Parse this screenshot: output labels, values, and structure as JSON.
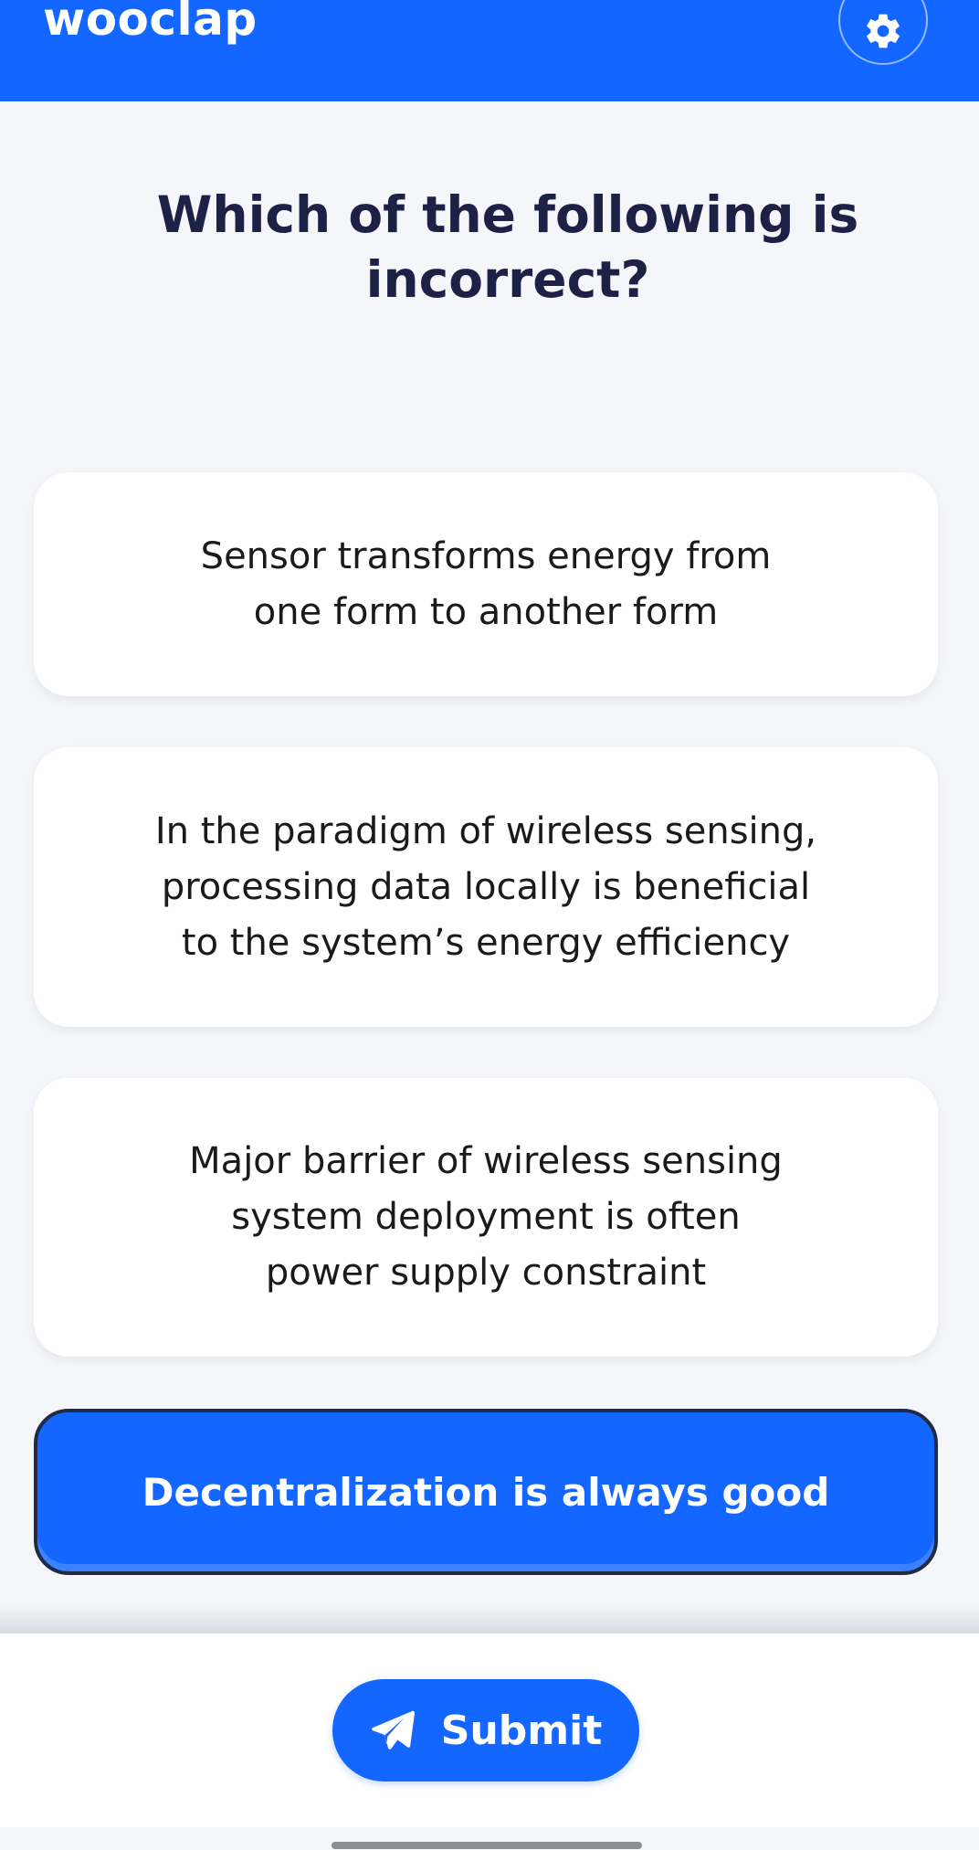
{
  "header": {
    "logo_text": "wooclap",
    "background_color": "#1366ff",
    "settings_icon": "gear-icon"
  },
  "question": {
    "text": "Which of the following is incorrect?"
  },
  "options": [
    {
      "label": "Sensor transforms energy from one form to another form",
      "selected": false
    },
    {
      "label": "In the paradigm of wireless sensing, processing data locally is beneficial to the system’s energy efficiency",
      "selected": false
    },
    {
      "label": "Major barrier of wireless sensing system deployment is often power supply constraint",
      "selected": false
    },
    {
      "label": "Decentralization is always good",
      "selected": true
    }
  ],
  "footer": {
    "submit_label": "Submit",
    "submit_icon": "send-icon"
  },
  "colors": {
    "accent": "#1366ff",
    "question_text": "#1c2145",
    "selected_border": "#1f2b46"
  }
}
